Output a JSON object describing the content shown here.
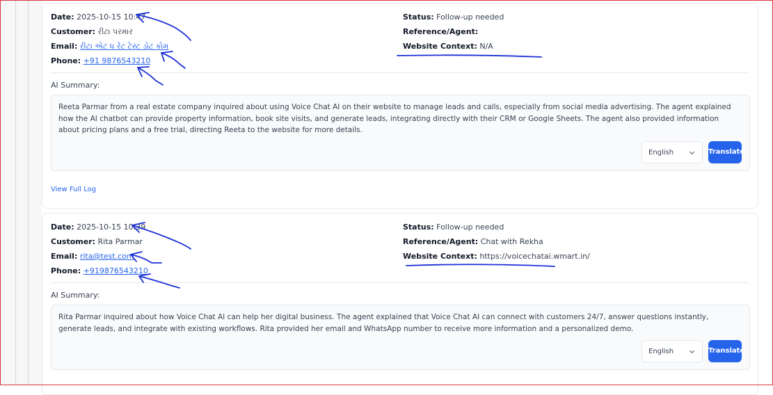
{
  "records": [
    {
      "date_label": "Date:",
      "date": "2025-10-15 10:47",
      "customer_label": "Customer:",
      "customer": "રીટા પરમાર",
      "email_label": "Email:",
      "email": "રીટા એટ ધ રેટ ટેસ્ટ ડોટ કોમ",
      "phone_label": "Phone:",
      "phone": "+91 9876543210",
      "status_label": "Status:",
      "status": "Follow-up needed",
      "reference_label": "Reference/Agent:",
      "reference": "",
      "website_label": "Website Context:",
      "website": "N/A",
      "summary_label": "AI Summary:",
      "summary": "Reeta Parmar from a real estate company inquired about using Voice Chat AI on their website to manage leads and calls, especially from social media advertising. The agent explained how the AI chatbot can provide property information, book site visits, and generate leads, integrating directly with their CRM or Google Sheets. The agent also provided information about pricing plans and a free trial, directing Reeta to the website for more details.",
      "language": "English",
      "translate_label": "Translate",
      "view_log_label": "View Full Log"
    },
    {
      "date_label": "Date:",
      "date": "2025-10-15 10:39",
      "customer_label": "Customer:",
      "customer": "Rita Parmar",
      "email_label": "Email:",
      "email": "rita@test.com",
      "phone_label": "Phone:",
      "phone": "+919876543210",
      "status_label": "Status:",
      "status": "Follow-up needed",
      "reference_label": "Reference/Agent:",
      "reference": "Chat with Rekha",
      "website_label": "Website Context:",
      "website": "https://voicechatai.wmart.in/",
      "summary_label": "AI Summary:",
      "summary": "Rita Parmar inquired about how Voice Chat AI can help her digital business. The agent explained that Voice Chat AI can connect with customers 24/7, answer questions instantly, generate leads, and integrate with existing workflows. Rita provided her email and WhatsApp number to receive more information and a personalized demo.",
      "language": "English",
      "translate_label": "Translate"
    }
  ],
  "colors": {
    "accent": "#2563eb",
    "annotation_ink": "#1a2fd6",
    "frame": "#d9353b"
  },
  "icons": [
    "chevron-down-icon"
  ]
}
